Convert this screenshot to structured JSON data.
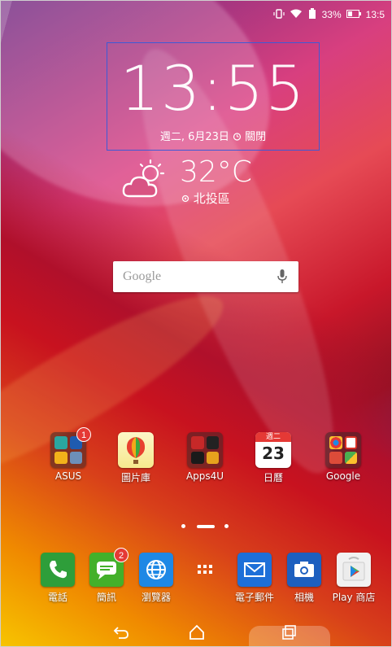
{
  "status_bar": {
    "icons": [
      "vibrate-icon",
      "wifi-icon",
      "battery-saver-icon"
    ],
    "battery": "33%",
    "time": "13:5"
  },
  "clock": {
    "time": "13:55",
    "date": "週二, 6月23日",
    "alarm": "關閉"
  },
  "weather": {
    "icon": "partly-cloudy-icon",
    "temperature": "32°C",
    "location": "北投區"
  },
  "search": {
    "placeholder": "Google"
  },
  "home_apps": [
    {
      "label": "ASUS",
      "badge": "1"
    },
    {
      "label": "圖片庫"
    },
    {
      "label": "Apps4U"
    },
    {
      "label": "日曆",
      "calendar_top": "週二",
      "calendar_day": "23"
    },
    {
      "label": "Google"
    }
  ],
  "dock": [
    {
      "label": "電話",
      "badge": ""
    },
    {
      "label": "簡訊",
      "badge": "2"
    },
    {
      "label": "瀏覽器"
    },
    {
      "label": "all-apps"
    },
    {
      "label": "電子郵件"
    },
    {
      "label": "相機"
    },
    {
      "label": "Play 商店"
    }
  ],
  "colors": {
    "phone": "#2e9e3a",
    "messages": "#43b02a",
    "browser": "#1e88e5",
    "email": "#1e6fd8",
    "camera": "#1d5fbf",
    "badge": "#e53935",
    "focus_border": "#3d5ad6"
  }
}
